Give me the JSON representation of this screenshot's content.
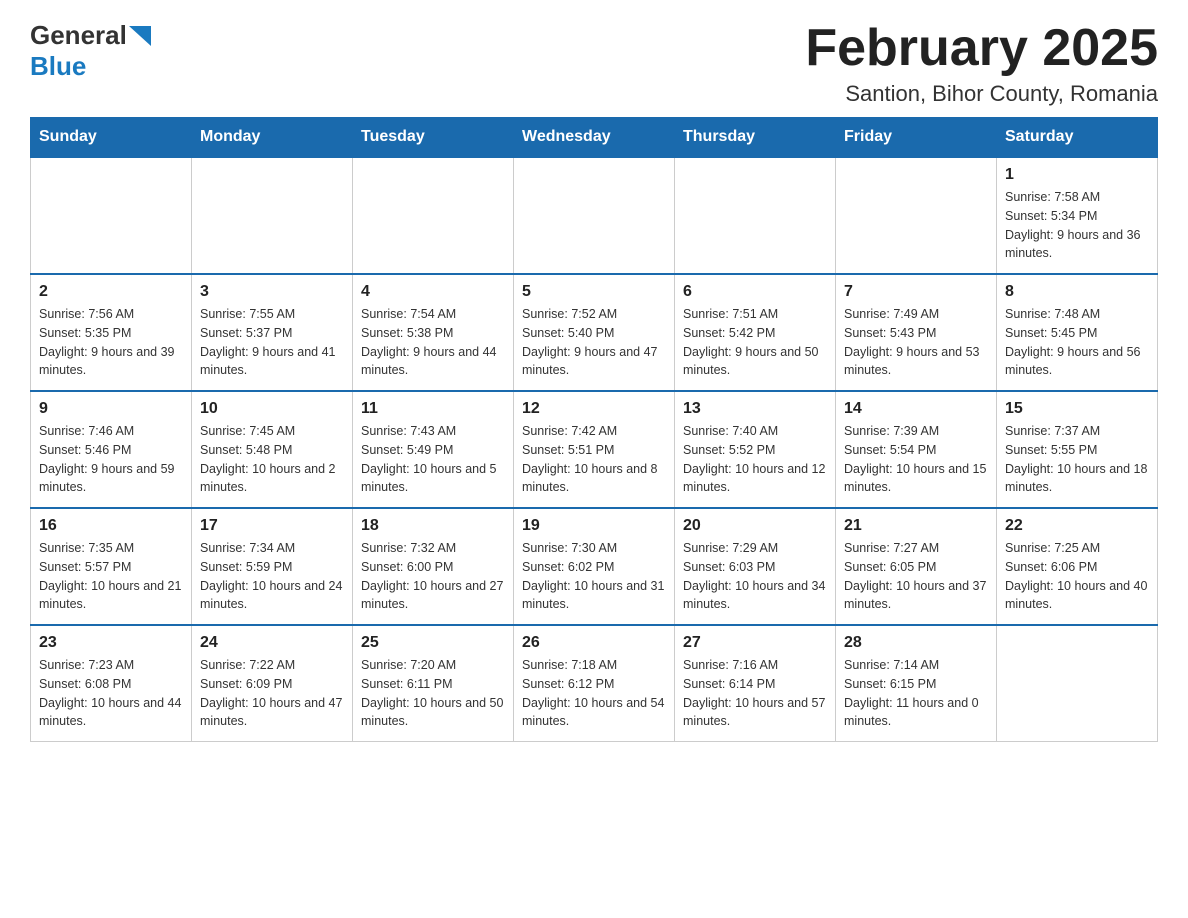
{
  "logo": {
    "general": "General",
    "blue": "Blue"
  },
  "title": "February 2025",
  "location": "Santion, Bihor County, Romania",
  "days_of_week": [
    "Sunday",
    "Monday",
    "Tuesday",
    "Wednesday",
    "Thursday",
    "Friday",
    "Saturday"
  ],
  "weeks": [
    [
      {
        "day": "",
        "info": ""
      },
      {
        "day": "",
        "info": ""
      },
      {
        "day": "",
        "info": ""
      },
      {
        "day": "",
        "info": ""
      },
      {
        "day": "",
        "info": ""
      },
      {
        "day": "",
        "info": ""
      },
      {
        "day": "1",
        "info": "Sunrise: 7:58 AM\nSunset: 5:34 PM\nDaylight: 9 hours and 36 minutes."
      }
    ],
    [
      {
        "day": "2",
        "info": "Sunrise: 7:56 AM\nSunset: 5:35 PM\nDaylight: 9 hours and 39 minutes."
      },
      {
        "day": "3",
        "info": "Sunrise: 7:55 AM\nSunset: 5:37 PM\nDaylight: 9 hours and 41 minutes."
      },
      {
        "day": "4",
        "info": "Sunrise: 7:54 AM\nSunset: 5:38 PM\nDaylight: 9 hours and 44 minutes."
      },
      {
        "day": "5",
        "info": "Sunrise: 7:52 AM\nSunset: 5:40 PM\nDaylight: 9 hours and 47 minutes."
      },
      {
        "day": "6",
        "info": "Sunrise: 7:51 AM\nSunset: 5:42 PM\nDaylight: 9 hours and 50 minutes."
      },
      {
        "day": "7",
        "info": "Sunrise: 7:49 AM\nSunset: 5:43 PM\nDaylight: 9 hours and 53 minutes."
      },
      {
        "day": "8",
        "info": "Sunrise: 7:48 AM\nSunset: 5:45 PM\nDaylight: 9 hours and 56 minutes."
      }
    ],
    [
      {
        "day": "9",
        "info": "Sunrise: 7:46 AM\nSunset: 5:46 PM\nDaylight: 9 hours and 59 minutes."
      },
      {
        "day": "10",
        "info": "Sunrise: 7:45 AM\nSunset: 5:48 PM\nDaylight: 10 hours and 2 minutes."
      },
      {
        "day": "11",
        "info": "Sunrise: 7:43 AM\nSunset: 5:49 PM\nDaylight: 10 hours and 5 minutes."
      },
      {
        "day": "12",
        "info": "Sunrise: 7:42 AM\nSunset: 5:51 PM\nDaylight: 10 hours and 8 minutes."
      },
      {
        "day": "13",
        "info": "Sunrise: 7:40 AM\nSunset: 5:52 PM\nDaylight: 10 hours and 12 minutes."
      },
      {
        "day": "14",
        "info": "Sunrise: 7:39 AM\nSunset: 5:54 PM\nDaylight: 10 hours and 15 minutes."
      },
      {
        "day": "15",
        "info": "Sunrise: 7:37 AM\nSunset: 5:55 PM\nDaylight: 10 hours and 18 minutes."
      }
    ],
    [
      {
        "day": "16",
        "info": "Sunrise: 7:35 AM\nSunset: 5:57 PM\nDaylight: 10 hours and 21 minutes."
      },
      {
        "day": "17",
        "info": "Sunrise: 7:34 AM\nSunset: 5:59 PM\nDaylight: 10 hours and 24 minutes."
      },
      {
        "day": "18",
        "info": "Sunrise: 7:32 AM\nSunset: 6:00 PM\nDaylight: 10 hours and 27 minutes."
      },
      {
        "day": "19",
        "info": "Sunrise: 7:30 AM\nSunset: 6:02 PM\nDaylight: 10 hours and 31 minutes."
      },
      {
        "day": "20",
        "info": "Sunrise: 7:29 AM\nSunset: 6:03 PM\nDaylight: 10 hours and 34 minutes."
      },
      {
        "day": "21",
        "info": "Sunrise: 7:27 AM\nSunset: 6:05 PM\nDaylight: 10 hours and 37 minutes."
      },
      {
        "day": "22",
        "info": "Sunrise: 7:25 AM\nSunset: 6:06 PM\nDaylight: 10 hours and 40 minutes."
      }
    ],
    [
      {
        "day": "23",
        "info": "Sunrise: 7:23 AM\nSunset: 6:08 PM\nDaylight: 10 hours and 44 minutes."
      },
      {
        "day": "24",
        "info": "Sunrise: 7:22 AM\nSunset: 6:09 PM\nDaylight: 10 hours and 47 minutes."
      },
      {
        "day": "25",
        "info": "Sunrise: 7:20 AM\nSunset: 6:11 PM\nDaylight: 10 hours and 50 minutes."
      },
      {
        "day": "26",
        "info": "Sunrise: 7:18 AM\nSunset: 6:12 PM\nDaylight: 10 hours and 54 minutes."
      },
      {
        "day": "27",
        "info": "Sunrise: 7:16 AM\nSunset: 6:14 PM\nDaylight: 10 hours and 57 minutes."
      },
      {
        "day": "28",
        "info": "Sunrise: 7:14 AM\nSunset: 6:15 PM\nDaylight: 11 hours and 0 minutes."
      },
      {
        "day": "",
        "info": ""
      }
    ]
  ]
}
